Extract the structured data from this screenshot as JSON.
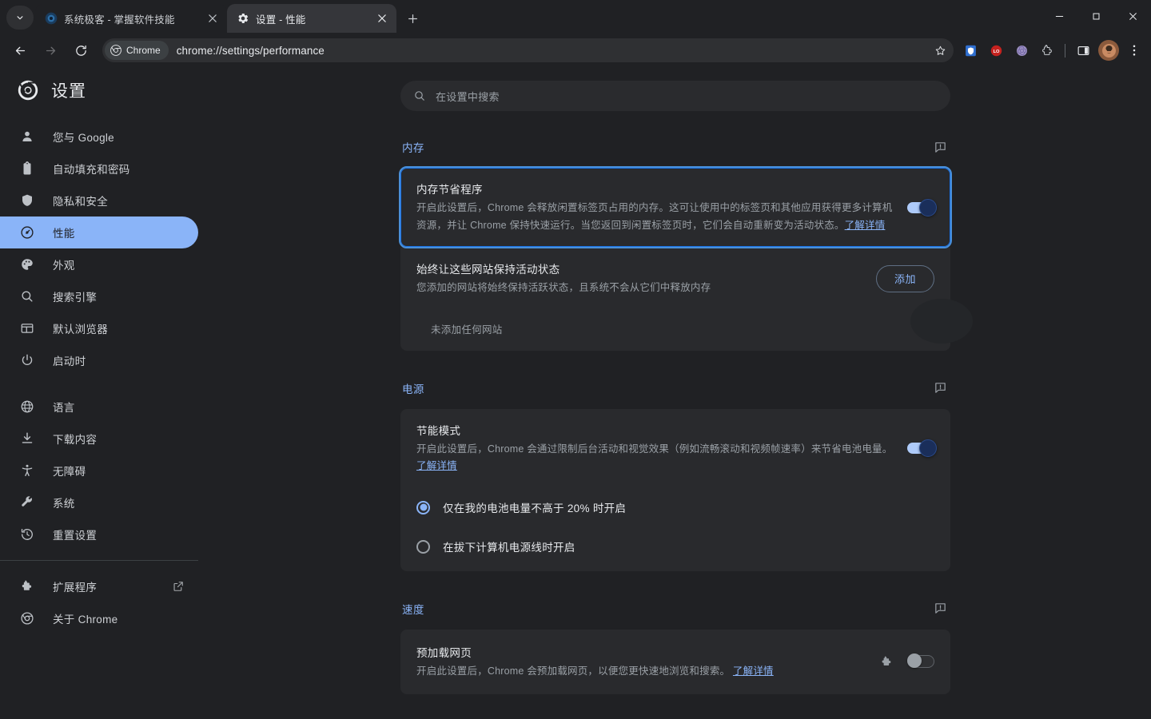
{
  "window": {
    "minimize_label": "最小化",
    "maximize_label": "还原",
    "close_label": "关闭"
  },
  "tabstrip": {
    "tab_search_label": "搜索标签页",
    "new_tab_label": "新建标签页",
    "tabs": [
      {
        "title": "系统极客 - 掌握软件技能",
        "favicon": "chrome-favicon",
        "active": false,
        "close_label": "关闭"
      },
      {
        "title": "设置 - 性能",
        "favicon": "gear-icon",
        "active": true,
        "close_label": "关闭"
      }
    ]
  },
  "toolbar": {
    "back_label": "返回",
    "forward_label": "前进",
    "reload_label": "重新加载",
    "chip_label": "Chrome",
    "url": "chrome://settings/performance",
    "bookmark_label": "为此标签页添加书签",
    "extensions": [
      {
        "name": "shield-extension-icon",
        "color": "#2f6fd0"
      },
      {
        "name": "red-badge-extension-icon",
        "color": "#c5221f"
      },
      {
        "name": "chatgpt-extension-icon",
        "color": "#9b8fc7"
      },
      {
        "name": "puzzle-extensions-icon",
        "color": "#c8ccd1"
      }
    ],
    "side_panel_label": "侧边栏",
    "profile_label": "个人资料",
    "menu_label": "自定义及控制 Google Chrome"
  },
  "sidebar": {
    "brand": "设置",
    "brand_logo": "chrome-logo-icon",
    "items": [
      {
        "label": "您与 Google",
        "icon": "person-icon",
        "active": false
      },
      {
        "label": "自动填充和密码",
        "icon": "clipboard-icon",
        "active": false
      },
      {
        "label": "隐私和安全",
        "icon": "shield-icon",
        "active": false
      },
      {
        "label": "性能",
        "icon": "speedometer-icon",
        "active": true
      },
      {
        "label": "外观",
        "icon": "palette-icon",
        "active": false
      },
      {
        "label": "搜索引擎",
        "icon": "search-icon",
        "active": false
      },
      {
        "label": "默认浏览器",
        "icon": "browser-icon",
        "active": false
      },
      {
        "label": "启动时",
        "icon": "power-icon",
        "active": false
      }
    ],
    "items_group2": [
      {
        "label": "语言",
        "icon": "globe-icon",
        "active": false
      },
      {
        "label": "下载内容",
        "icon": "download-icon",
        "active": false
      },
      {
        "label": "无障碍",
        "icon": "accessibility-icon",
        "active": false
      },
      {
        "label": "系统",
        "icon": "wrench-icon",
        "active": false
      },
      {
        "label": "重置设置",
        "icon": "history-icon",
        "active": false
      }
    ],
    "items_group3": [
      {
        "label": "扩展程序",
        "icon": "puzzle-icon",
        "external": true,
        "active": false
      },
      {
        "label": "关于 Chrome",
        "icon": "chrome-icon",
        "external": false,
        "active": false
      }
    ]
  },
  "search": {
    "placeholder": "在设置中搜索",
    "value": "",
    "icon": "search-icon"
  },
  "sections": {
    "memory": {
      "title": "内存",
      "feedback_label": "发送反馈",
      "memory_saver": {
        "title": "内存节省程序",
        "description": "开启此设置后，Chrome 会释放闲置标签页占用的内存。这可让使用中的标签页和其他应用获得更多计算机资源，并让 Chrome 保持快速运行。当您返回到闲置标签页时，它们会自动重新变为活动状态。",
        "link": "了解详情",
        "toggle_state": "on",
        "toggle_label": "内存节省程序开关"
      },
      "keep_active": {
        "title": "始终让这些网站保持活动状态",
        "description": "您添加的网站将始终保持活跃状态，且系统不会从它们中释放内存",
        "add_button": "添加",
        "empty_text": "未添加任何网站"
      }
    },
    "power": {
      "title": "电源",
      "feedback_label": "发送反馈",
      "energy_saver": {
        "title": "节能模式",
        "description": "开启此设置后，Chrome 会通过限制后台活动和视觉效果（例如流畅滚动和视频帧速率）来节省电池电量。",
        "link": "了解详情",
        "toggle_state": "on",
        "toggle_label": "节能模式开关"
      },
      "options": [
        {
          "label": "仅在我的电池电量不高于 20% 时开启",
          "selected": true
        },
        {
          "label": "在拔下计算机电源线时开启",
          "selected": false
        }
      ]
    },
    "speed": {
      "title": "速度",
      "feedback_label": "发送反馈",
      "preload": {
        "title": "预加载网页",
        "description": "开启此设置后，Chrome 会预加载网页，以便您更快速地浏览和搜索。",
        "link": "了解详情",
        "toggle_state": "off",
        "toggle_label": "预加载网页开关",
        "managed_icon": "puzzle-icon"
      }
    }
  },
  "colors": {
    "accent": "#8ab4f8",
    "page_bg": "#202124",
    "card_bg": "#292a2d",
    "active_nav_bg": "#8ab4f8",
    "focus_ring": "#1a73e8",
    "muted_text": "#9aa0a6"
  }
}
